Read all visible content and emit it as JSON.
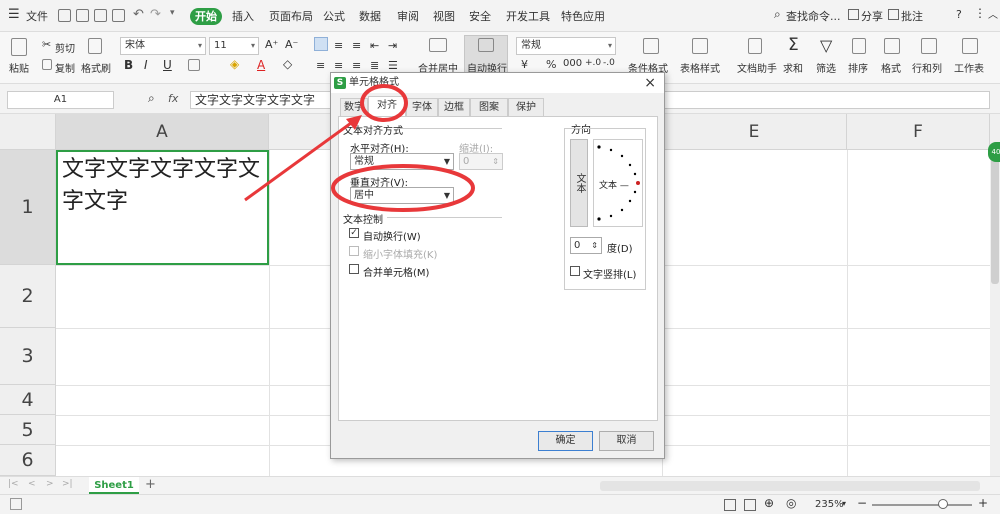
{
  "menubar": {
    "file_label": "文件",
    "tabs": [
      "插入",
      "页面布局",
      "公式",
      "数据",
      "审阅",
      "视图",
      "安全",
      "开发工具",
      "特色应用"
    ],
    "active_tab": "开始",
    "search_label": "查找命令...",
    "share_label": "分享",
    "annotate_label": "批注",
    "help": "?"
  },
  "ribbon": {
    "paste": "粘贴",
    "cut": "剪切",
    "copy": "复制",
    "format_painter": "格式刷",
    "font_name": "宋体",
    "font_size": "11",
    "merge_center": "合并居中",
    "wrap_text": "自动换行",
    "number_format": "常规",
    "conditional_format": "条件格式",
    "table_style": "表格样式",
    "doc_helper": "文档助手",
    "sum": "求和",
    "filter": "筛选",
    "sort": "排序",
    "format": "格式",
    "row_col": "行和列",
    "worksheet": "工作表"
  },
  "formula_bar": {
    "name_box": "A1",
    "fx": "fx",
    "content": "文字文字文字文字文字"
  },
  "grid": {
    "columns": [
      "A",
      "E",
      "F"
    ],
    "rows": [
      "1",
      "2",
      "3",
      "4",
      "5",
      "6"
    ],
    "cell_a1": "文字文字文字文字文字文字"
  },
  "sheet": {
    "tab": "Sheet1",
    "add": "+"
  },
  "status": {
    "zoom": "235%",
    "minus": "−",
    "plus": "+"
  },
  "dialog": {
    "title": "单元格格式",
    "close": "×",
    "tabs": [
      "数字",
      "对齐",
      "字体",
      "边框",
      "图案",
      "保护"
    ],
    "active_tab": "对齐",
    "text_alignment_section": "文本对齐方式",
    "horizontal_label": "水平对齐(H):",
    "horizontal_value": "常规",
    "indent_label": "缩进(I):",
    "indent_value": "0",
    "vertical_label": "垂直对齐(V):",
    "vertical_value": "居中",
    "text_control_section": "文本控制",
    "wrap_label": "自动换行(W)",
    "wrap_checked": true,
    "shrink_label": "缩小字体填充(K)",
    "merge_label": "合并单元格(M)",
    "orientation_section": "方向",
    "orient_vertical_text": "文本",
    "orient_text": "文本 —",
    "degree_value": "0",
    "degree_label": "度(D)",
    "rtl_label": "文字竖排(L)",
    "ok_label": "确定",
    "cancel_label": "取消"
  },
  "colors": {
    "accent": "#2e9e45",
    "annotation": "#e8383a"
  }
}
